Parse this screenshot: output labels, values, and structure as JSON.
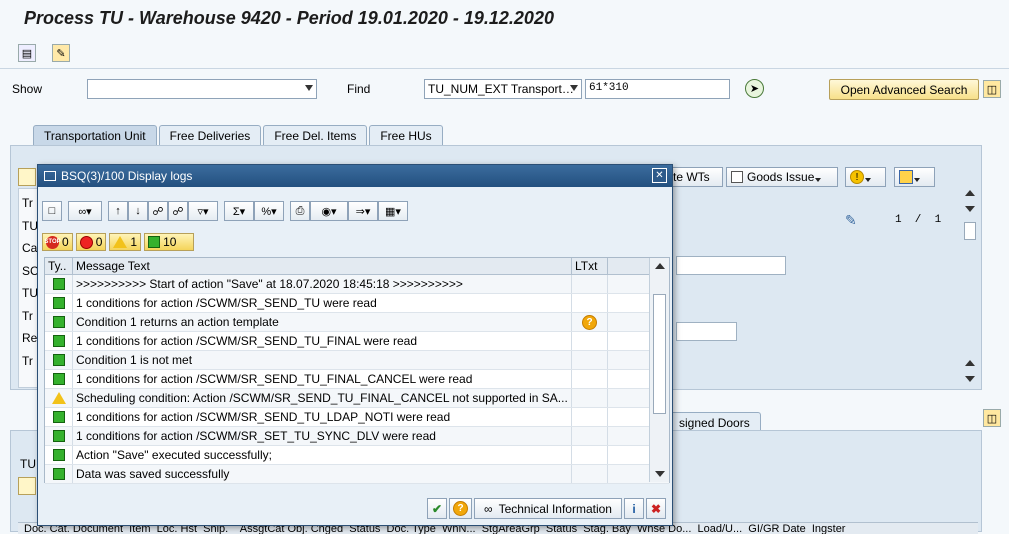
{
  "title": "Process TU - Warehouse 9420 - Period 19.01.2020 - 19.12.2020",
  "search": {
    "show_label": "Show",
    "show_value": "",
    "find_label": "Find",
    "find_field": "TU_NUM_EXT Transport…",
    "find_value": "61*310",
    "advanced_search": "Open Advanced Search"
  },
  "tabs": [
    "Transportation Unit",
    "Free Deliveries",
    "Free Del. Items",
    "Free HUs"
  ],
  "toolbar": {
    "create_wts": "te WTs",
    "goods_issue": "Goods Issue"
  },
  "pager": "1  /  1",
  "left_labels": [
    "Tr",
    "TU",
    "Ca",
    "SC",
    "TU",
    "Tr",
    "Re",
    "Tr"
  ],
  "lower": {
    "assigned_doors_tab": "signed Doors",
    "tu_label": "TU",
    "col_headers": "Doc. Cat. Document  Item  Loc. Hst  Ship.    AssgtCat Obj. Chged  Status  Doc. Type  WhN...  StgAreaGrp  Status  Stag. Bay  Whse Do...  Load/U...  GI/GR Date  Ingster"
  },
  "dialog": {
    "title": "BSQ(3)/100 Display logs",
    "counts": {
      "stop": "0",
      "error": "0",
      "warning": "1",
      "ok": "10"
    },
    "columns": {
      "type": "Ty..",
      "message": "Message Text",
      "ltxt": "LTxt"
    },
    "rows": [
      {
        "type": "ok",
        "text": ">>>>>>>>>> Start of action \"Save\" at 18.07.2020 18:45:18 >>>>>>>>>>",
        "help": false
      },
      {
        "type": "ok",
        "text": "1 conditions for action /SCWM/SR_SEND_TU were read",
        "help": false
      },
      {
        "type": "ok",
        "text": "Condition 1 returns an action template",
        "help": true
      },
      {
        "type": "ok",
        "text": "1 conditions for action /SCWM/SR_SEND_TU_FINAL were read",
        "help": false
      },
      {
        "type": "ok",
        "text": "Condition 1 is not met",
        "help": false
      },
      {
        "type": "ok",
        "text": "1 conditions for action /SCWM/SR_SEND_TU_FINAL_CANCEL were read",
        "help": false
      },
      {
        "type": "warn",
        "text": "Scheduling condition: Action /SCWM/SR_SEND_TU_FINAL_CANCEL not supported in SA...",
        "help": false
      },
      {
        "type": "ok",
        "text": "1 conditions for action /SCWM/SR_SEND_TU_LDAP_NOTI were read",
        "help": false
      },
      {
        "type": "ok",
        "text": "1 conditions for action /SCWM/SR_SET_TU_SYNC_DLV were read",
        "help": false
      },
      {
        "type": "ok",
        "text": "Action \"Save\" executed successfully;",
        "help": false
      },
      {
        "type": "ok",
        "text": "Data was saved successfully",
        "help": false
      }
    ],
    "technical_info": "Technical Information"
  }
}
